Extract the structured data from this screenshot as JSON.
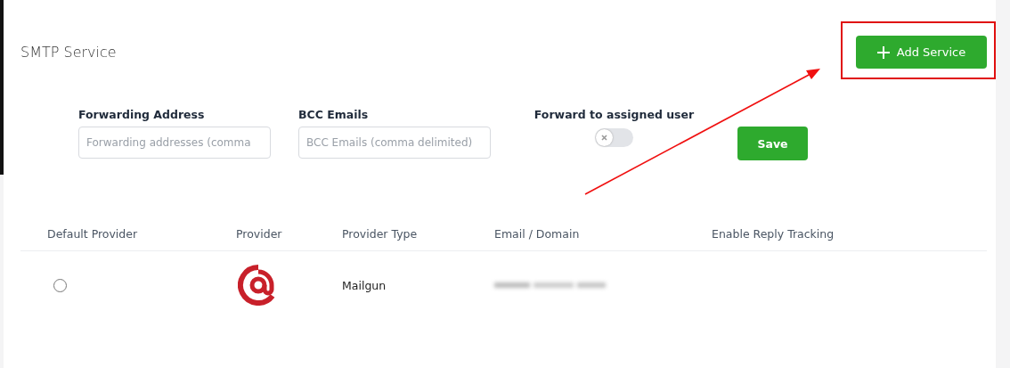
{
  "header": {
    "title": "SMTP Service",
    "add_button": "Add Service"
  },
  "form": {
    "fields": [
      {
        "label": "Forwarding Address",
        "placeholder": "Forwarding addresses (comma"
      },
      {
        "label": "BCC Emails",
        "placeholder": "BCC Emails (comma delimited)"
      }
    ],
    "toggle": {
      "label": "Forward to assigned user",
      "on": false
    },
    "save_button": "Save"
  },
  "table": {
    "columns": [
      "Default Provider",
      "Provider",
      "Provider Type",
      "Email / Domain",
      "Enable Reply Tracking"
    ],
    "rows": [
      {
        "selected": false,
        "provider_type": "Mailgun"
      }
    ]
  }
}
